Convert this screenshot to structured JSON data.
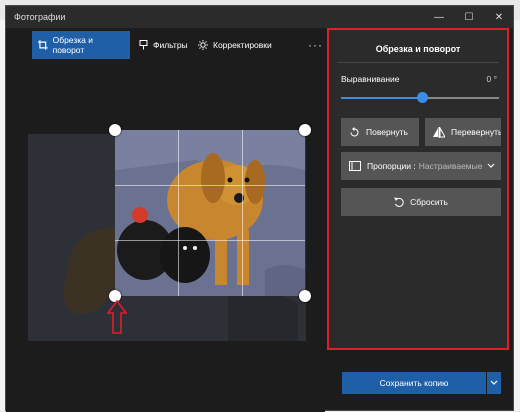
{
  "window": {
    "title": "Фотографии"
  },
  "controls": {
    "minimize": "—",
    "maximize": "☐",
    "close": "✕"
  },
  "tabs": [
    {
      "label": "Обрезка и поворот",
      "icon": "crop-icon",
      "active": true
    },
    {
      "label": "Фильтры",
      "icon": "filter-icon",
      "active": false
    },
    {
      "label": "Корректировки",
      "icon": "brightness-icon",
      "active": false
    }
  ],
  "toolbar": {
    "more": "···"
  },
  "panel": {
    "title": "Обрезка и поворот",
    "align_label": "Выравнивание",
    "align_value": "0 °",
    "align_level": 0.5,
    "rotate_label": "Повернуть",
    "flip_label": "Перевернуть",
    "aspect_label": "Пропорции :",
    "aspect_value": "Настраиваемые",
    "reset_label": "Сбросить"
  },
  "footer": {
    "save_label": "Сохранить копию"
  },
  "colors": {
    "accent": "#1e5fa8",
    "highlight_border": "#e11d2a",
    "arrow": "#e11d2a"
  }
}
